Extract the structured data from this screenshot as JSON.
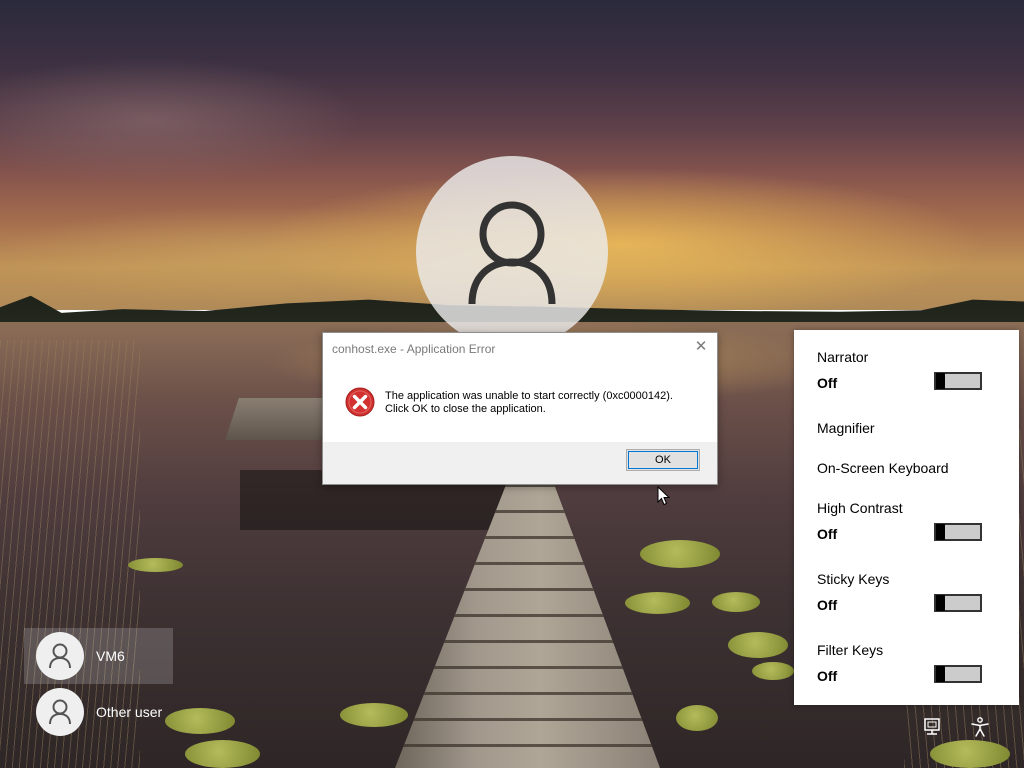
{
  "dialog": {
    "title": "conhost.exe - Application Error",
    "message_line1": "The application was unable to start correctly (0xc0000142).",
    "message_line2": "Click OK to close the application.",
    "ok_label": "OK",
    "close_glyph": "✕",
    "icon": "error-icon"
  },
  "ease_of_access": {
    "narrator": {
      "label": "Narrator",
      "state": "Off"
    },
    "magnifier": {
      "label": "Magnifier"
    },
    "onscreen_keyboard": {
      "label": "On-Screen Keyboard"
    },
    "high_contrast": {
      "label": "High Contrast",
      "state": "Off"
    },
    "sticky_keys": {
      "label": "Sticky Keys",
      "state": "Off"
    },
    "filter_keys": {
      "label": "Filter Keys",
      "state": "Off"
    }
  },
  "users": [
    {
      "name": "VM6",
      "selected": true
    },
    {
      "name": "Other user",
      "selected": false
    }
  ],
  "tray": {
    "network_icon": "network-icon",
    "accessibility_icon": "accessibility-icon"
  },
  "colors": {
    "dialog_bg": "#ffffff",
    "dialog_footer": "#f0f0f0",
    "error_red": "#d2312f",
    "focus_blue": "#0078d7"
  }
}
